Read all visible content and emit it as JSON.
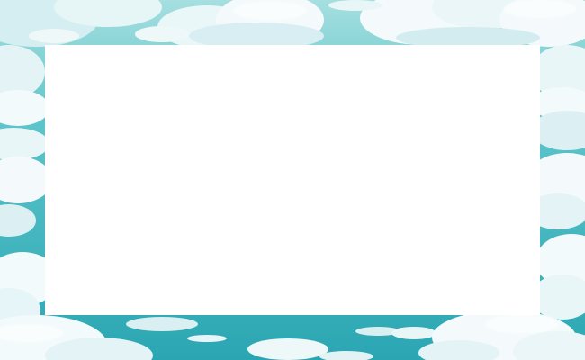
{
  "scene": {
    "background": "cartoon-sky-with-clouds",
    "colors": {
      "sky_top": "#9fdcdc",
      "sky_mid": "#48bcc3",
      "sky_bottom": "#2aa9b4",
      "cloud": "#f4fafb",
      "cloud_shadow": "#c6e5ea",
      "panel": "#ffffff"
    }
  },
  "panel": {
    "label": "",
    "contents": []
  }
}
